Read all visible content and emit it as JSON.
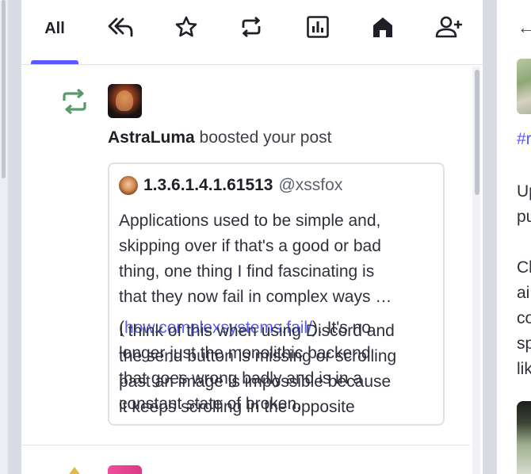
{
  "tabs": {
    "all_label": "All",
    "items": [
      {
        "name": "tab-mentions",
        "icon": "reply-all-icon"
      },
      {
        "name": "tab-favourites",
        "icon": "star-icon"
      },
      {
        "name": "tab-boosts",
        "icon": "boost-icon"
      },
      {
        "name": "tab-polls",
        "icon": "poll-chart-icon"
      },
      {
        "name": "tab-home",
        "icon": "home-icon"
      },
      {
        "name": "tab-follows",
        "icon": "add-person-icon"
      }
    ],
    "accent": "#595aff"
  },
  "notification": {
    "type_icon": "boost-icon",
    "icon_color": "#5a9a69",
    "actor": "AstraLuma",
    "action": " boosted your post",
    "status": {
      "display_name": "1.3.6.1.4.1.61513",
      "handle": "@xssfox",
      "lines": [
        "Applications used to be simple and,",
        "skipping over if that's a good or bad",
        "thing, one thing I find fascinating is",
        "that they now fail in complex  ways …"
      ],
      "overlap_a": {
        "prefix": "(",
        "link": "how.complexsystems.fail/",
        "after_link": "). It's no",
        "line2": "longer just the monolithic backend",
        "line3": "that goes wrong badly and is in a",
        "line4": "constant state of broken."
      },
      "overlap_b": {
        "line1": "I think of this when using Discord and",
        "line2": "the send button is missing or scrolling",
        "line3": "past an image is impossible because",
        "line4": "it keeps scrolling in the opposite"
      }
    }
  },
  "right_panel": {
    "back_icon": "arrow-left-icon",
    "hashtag": "#r",
    "text_lines_1": [
      "Up",
      "pu"
    ],
    "text_lines_2": [
      "Cl",
      "ai",
      "co",
      "sp",
      "lik"
    ]
  }
}
